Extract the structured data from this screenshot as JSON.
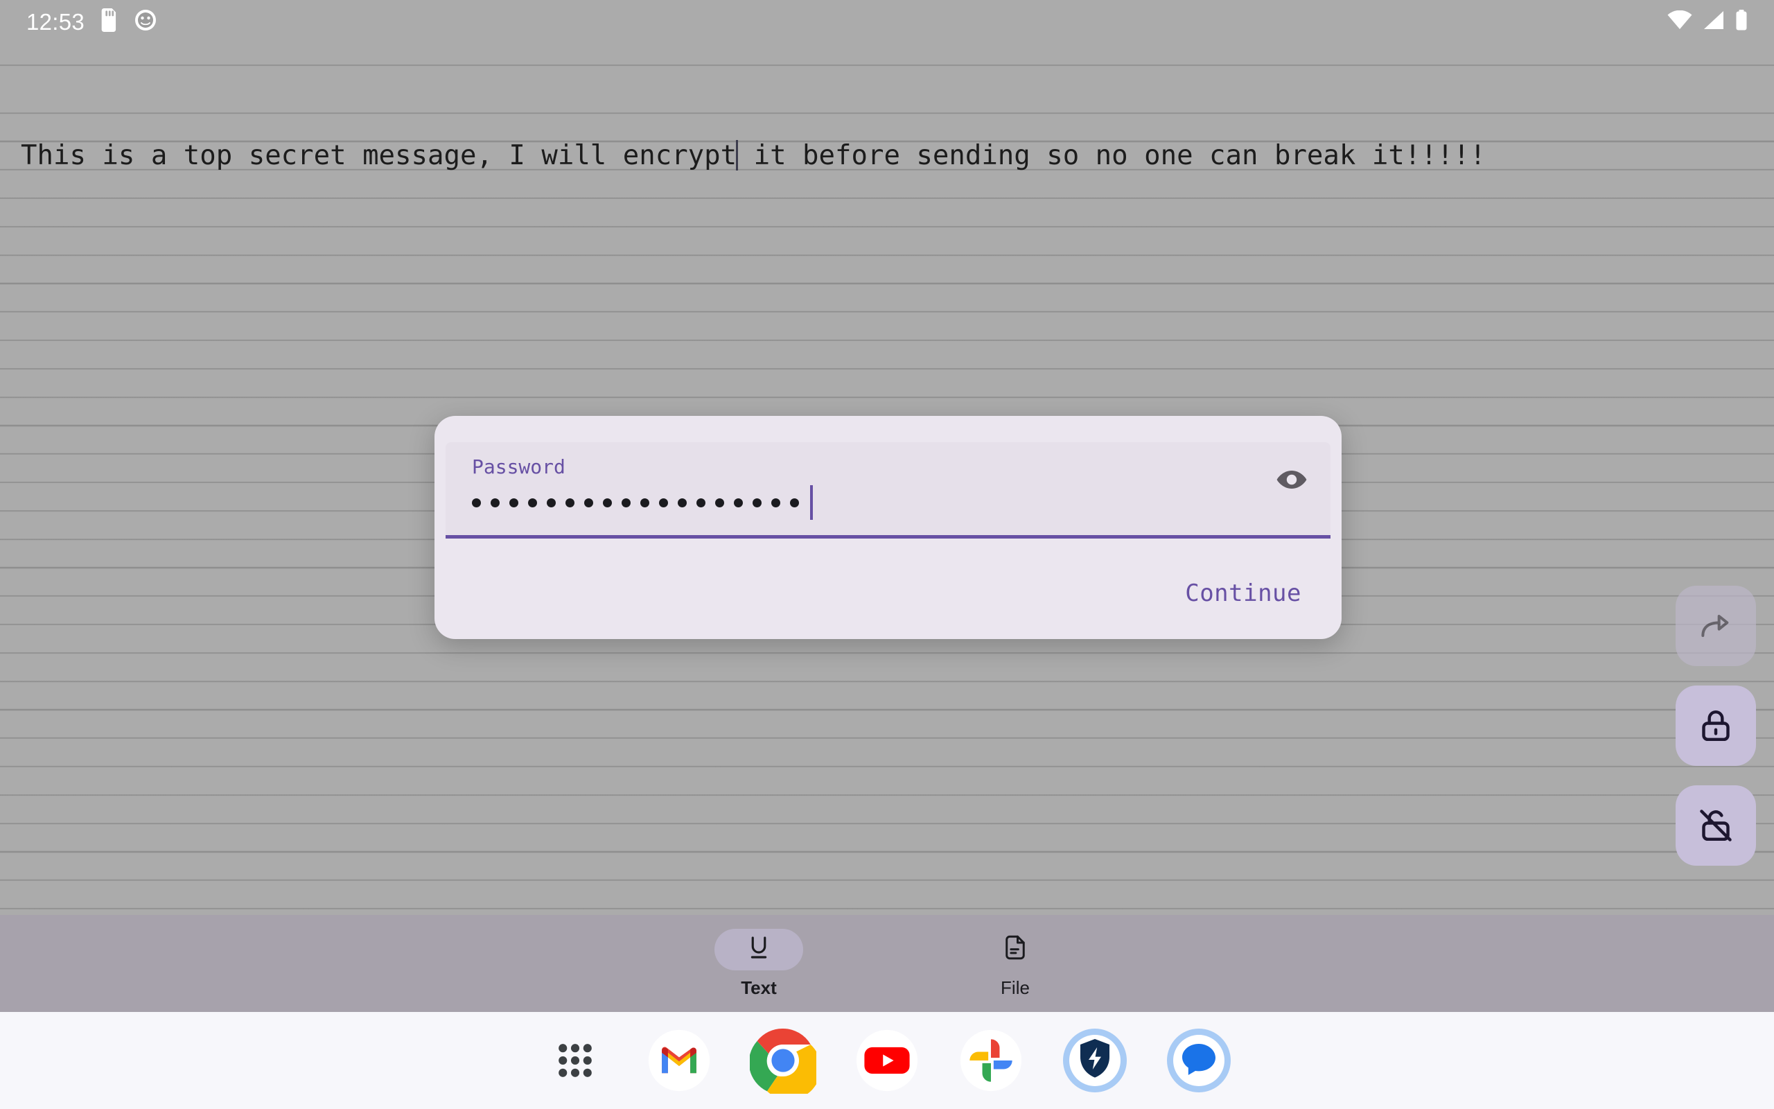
{
  "status_bar": {
    "clock": "12:53",
    "left_icons": [
      "sd-card-icon",
      "app-notification-icon"
    ],
    "right_icons": [
      "wifi-icon",
      "cellular-signal-icon",
      "battery-icon"
    ]
  },
  "note": {
    "text_before_caret": "This is a top secret message, I will encrypt",
    "text_after_caret": " it before sending so no one can break it!!!!!",
    "full_text": "This is a top secret message, I will encrypt it before sending so no one can break it!!!!!"
  },
  "side_actions": [
    {
      "name": "share-button",
      "icon": "share-arrow-icon",
      "enabled": false
    },
    {
      "name": "encrypt-button",
      "icon": "lock-icon",
      "enabled": true
    },
    {
      "name": "decrypt-button",
      "icon": "lock-off-icon",
      "enabled": true
    }
  ],
  "dialog": {
    "field_label": "Password",
    "field_value": "••••••••••••••••••",
    "field_placeholder": "Password",
    "dot_count": 18,
    "visibility_toggle_icon": "eye-icon",
    "confirm_label": "Continue",
    "accent_color": "#6750a4",
    "surface_color": "#ebe6ef"
  },
  "mode_bar": {
    "items": [
      {
        "label": "Text",
        "icon": "format-underline-icon",
        "selected": true
      },
      {
        "label": "File",
        "icon": "document-icon",
        "selected": false
      }
    ]
  },
  "dock": {
    "items": [
      {
        "name": "app-drawer-icon",
        "label": "All apps"
      },
      {
        "name": "gmail-icon",
        "label": "Gmail"
      },
      {
        "name": "chrome-icon",
        "label": "Chrome"
      },
      {
        "name": "youtube-icon",
        "label": "YouTube"
      },
      {
        "name": "google-photos-icon",
        "label": "Photos"
      },
      {
        "name": "shield-bolt-icon",
        "label": "Security"
      },
      {
        "name": "google-messages-icon",
        "label": "Messages"
      }
    ]
  }
}
